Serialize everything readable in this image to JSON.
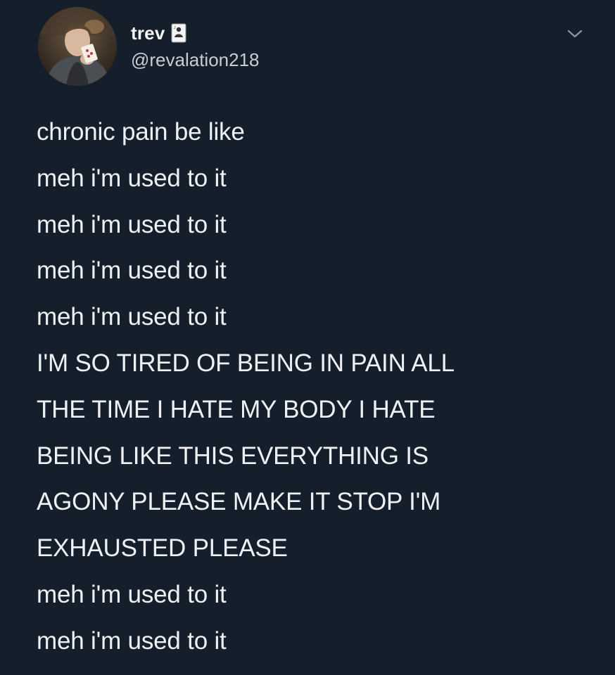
{
  "author": {
    "display_name": "trev",
    "handle": "@revalation218",
    "avatar_icon": "profile-photo",
    "badge_icon": "playing-card-icon"
  },
  "menu": {
    "icon": "chevron-down-icon"
  },
  "tweet": {
    "lines": [
      "chronic pain be like",
      "meh i'm used to it",
      "meh i'm used to it",
      "meh i'm used to it",
      "meh i'm used to it",
      "I'M SO TIRED OF BEING IN PAIN ALL",
      "THE TIME I HATE MY BODY I HATE",
      "BEING LIKE THIS EVERYTHING IS",
      "AGONY PLEASE MAKE IT STOP I'M",
      "EXHAUSTED PLEASE",
      "meh i'm used to it",
      "meh i'm used to it"
    ]
  },
  "colors": {
    "background": "#151f2b",
    "text": "#eef1f4",
    "secondary_text": "#c7cdd3"
  }
}
